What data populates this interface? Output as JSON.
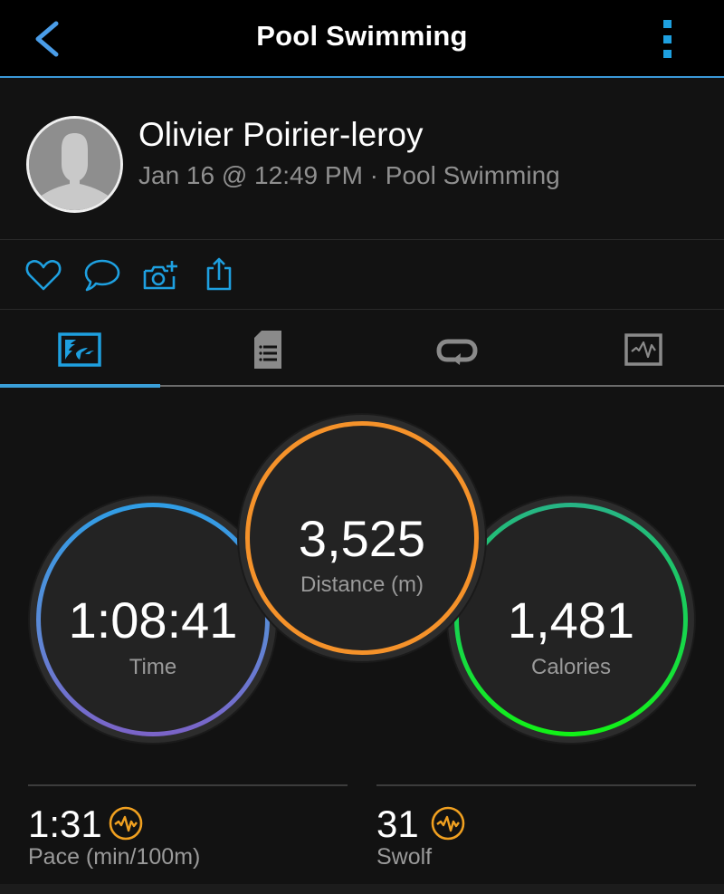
{
  "topbar": {
    "title": "Pool Swimming",
    "back_icon": "chevron-left-icon",
    "more_icon": "vertical-ellipsis-icon",
    "accent": "#3a98d8"
  },
  "header": {
    "user_name": "Olivier Poirier-leroy",
    "date": "Jan 16 @ 12:49 PM",
    "separator": "·",
    "activity_type": "Pool Swimming",
    "sub_line": "Jan 16 @ 12:49 PM · Pool Swimming"
  },
  "actions": [
    {
      "name": "like",
      "icon": "heart-icon"
    },
    {
      "name": "comment",
      "icon": "speech-bubble-icon"
    },
    {
      "name": "add-photo",
      "icon": "camera-plus-icon"
    },
    {
      "name": "share",
      "icon": "share-icon"
    }
  ],
  "tabs": [
    {
      "name": "overview",
      "icon": "swim-overview-icon",
      "active": true
    },
    {
      "name": "details",
      "icon": "document-list-icon",
      "active": false
    },
    {
      "name": "laps",
      "icon": "loop-arrow-icon",
      "active": false
    },
    {
      "name": "charts",
      "icon": "activity-chart-icon",
      "active": false
    }
  ],
  "rings": {
    "time": {
      "value": "1:08:41",
      "label": "Time",
      "colors": [
        "#2f9ee6",
        "#7b63c8"
      ]
    },
    "distance": {
      "value": "3,525",
      "label": "Distance (m)",
      "color": "#f5922a"
    },
    "calories": {
      "value": "1,481",
      "label": "Calories",
      "colors": [
        "#27b486",
        "#12f216"
      ]
    }
  },
  "stats": [
    {
      "value": "1:31",
      "label": "Pace (min/100m)",
      "icon": "performance-pulse-icon",
      "icon_color": "#f0a020"
    },
    {
      "value": "31",
      "label": "Swolf",
      "icon": "performance-pulse-icon",
      "icon_color": "#f0a020"
    }
  ]
}
